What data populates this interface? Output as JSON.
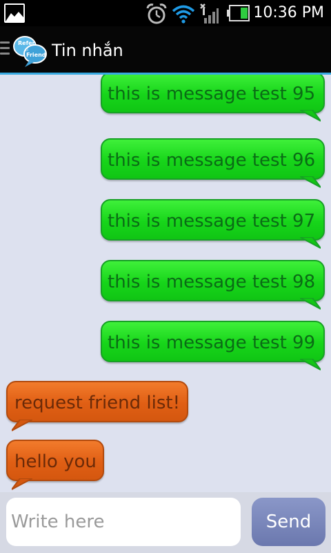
{
  "status_bar": {
    "time": "10:36 PM",
    "icons": [
      "gallery-notification-icon",
      "alarm-icon",
      "wifi-icon",
      "signal-icon",
      "battery-icon"
    ]
  },
  "action_bar": {
    "logo_text": [
      "Refer",
      "ci",
      "Friend"
    ],
    "title": "Tin nhắn"
  },
  "messages": [
    {
      "direction": "sent",
      "text": "this is message test 95"
    },
    {
      "direction": "sent",
      "text": "this is message test 96"
    },
    {
      "direction": "sent",
      "text": "this is message test 97"
    },
    {
      "direction": "sent",
      "text": "this is message test 98"
    },
    {
      "direction": "sent",
      "text": "this is message test 99"
    },
    {
      "direction": "received",
      "text": "request friend list!"
    },
    {
      "direction": "received",
      "text": "hello you"
    }
  ],
  "composer": {
    "placeholder": "Write here",
    "value": "",
    "send_label": "Send"
  },
  "colors": {
    "sent_bubble": "#22dd22",
    "received_bubble": "#e0621a",
    "chat_background": "#dde1ef",
    "action_bar_accent": "#38a9e0",
    "send_button": "#7a87bd"
  }
}
